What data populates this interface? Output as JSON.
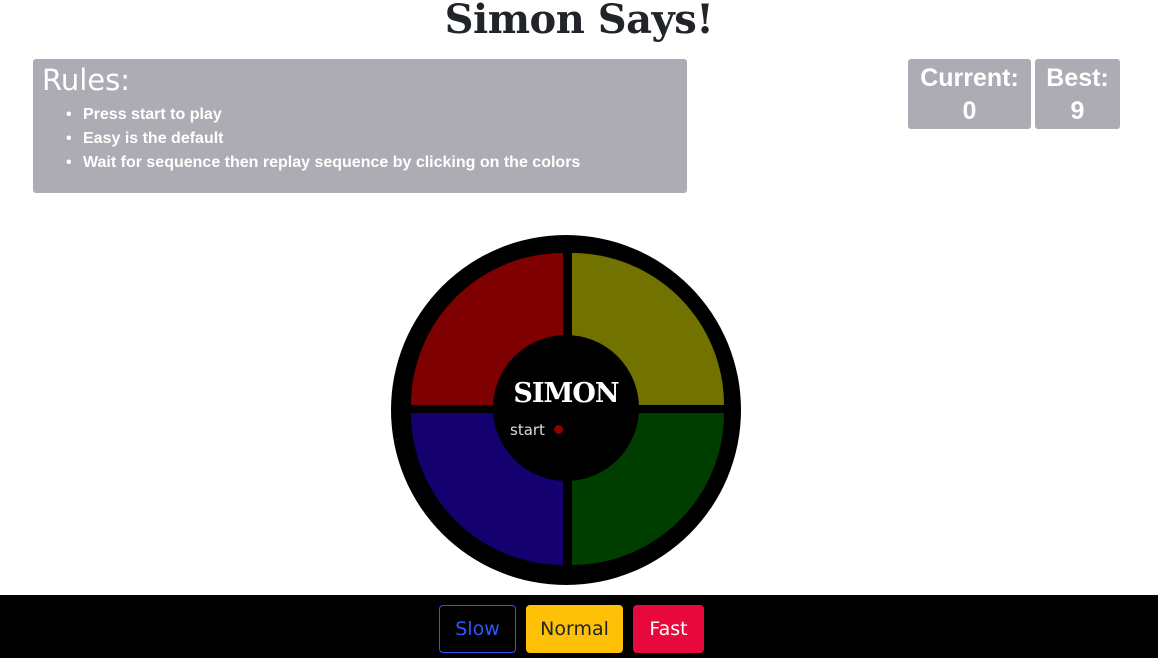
{
  "title": "Simon Says!",
  "rules": {
    "heading": "Rules:",
    "items": [
      "Press start to play",
      "Easy is the default",
      "Wait for sequence then replay sequence by clicking on the colors"
    ]
  },
  "scores": {
    "current_label": "Current:",
    "current_value": "0",
    "best_label": "Best:",
    "best_value": "9"
  },
  "board": {
    "logo": "SIMON",
    "start_label": "start",
    "start_indicator_color": "#8b0000",
    "pads": [
      {
        "name": "red",
        "color": "#7e0000"
      },
      {
        "name": "yellow",
        "color": "#727200"
      },
      {
        "name": "blue",
        "color": "#14006f"
      },
      {
        "name": "green",
        "color": "#003e00"
      }
    ]
  },
  "speed": {
    "slow_label": "Slow",
    "normal_label": "Normal",
    "fast_label": "Fast"
  }
}
